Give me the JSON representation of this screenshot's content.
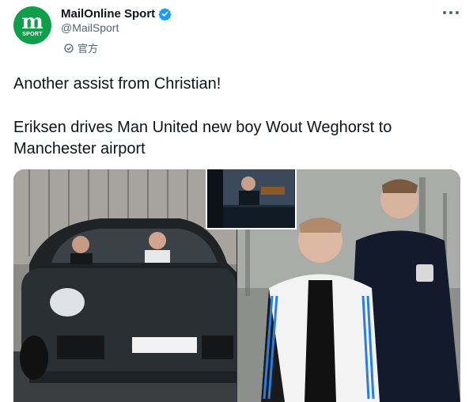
{
  "account": {
    "display_name": "MailOnline Sport",
    "handle": "@MailSport",
    "official_label": "官方",
    "avatar_mark": "m",
    "avatar_sub": "SPORT"
  },
  "tweet": {
    "line1": "Another assist from Christian!",
    "line2": "Eriksen drives Man United new boy Wout Weghorst to Manchester airport"
  },
  "icons": {
    "verified": "verified-badge-icon",
    "more": "more-options-icon",
    "official": "official-badge-icon"
  },
  "colors": {
    "brand_green": "#0e9f4a",
    "verified_blue": "#1d9bf0",
    "text_primary": "#0f1419",
    "text_secondary": "#536471"
  }
}
